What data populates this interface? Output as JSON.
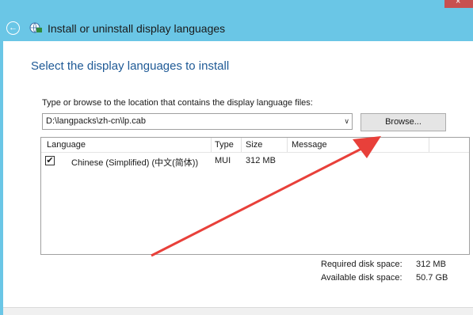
{
  "window": {
    "title": "Install or uninstall display languages",
    "back_icon": "←",
    "close_icon": "×"
  },
  "heading": "Select the display languages to install",
  "prompt": "Type or browse to the location that contains the display language files:",
  "path_field": {
    "value": "D:\\langpacks\\zh-cn\\lp.cab",
    "dropdown_icon": "∨"
  },
  "browse_label": "Browse...",
  "table": {
    "columns": [
      "Language",
      "Type",
      "Size",
      "Message"
    ],
    "rows": [
      {
        "checked": true,
        "check_glyph": "✔",
        "language": "Chinese (Simplified) (中文(简体))",
        "type": "MUI",
        "size": "312 MB",
        "message": ""
      }
    ]
  },
  "disk": {
    "required_label": "Required disk space:",
    "required_value": "312 MB",
    "available_label": "Available disk space:",
    "available_value": "50.7 GB"
  },
  "colors": {
    "titlebar": "#6ac6e6",
    "heading": "#1f5a96",
    "arrow": "#e8403a"
  },
  "annotation": {
    "type": "arrow",
    "points_to": "Browse... button"
  }
}
